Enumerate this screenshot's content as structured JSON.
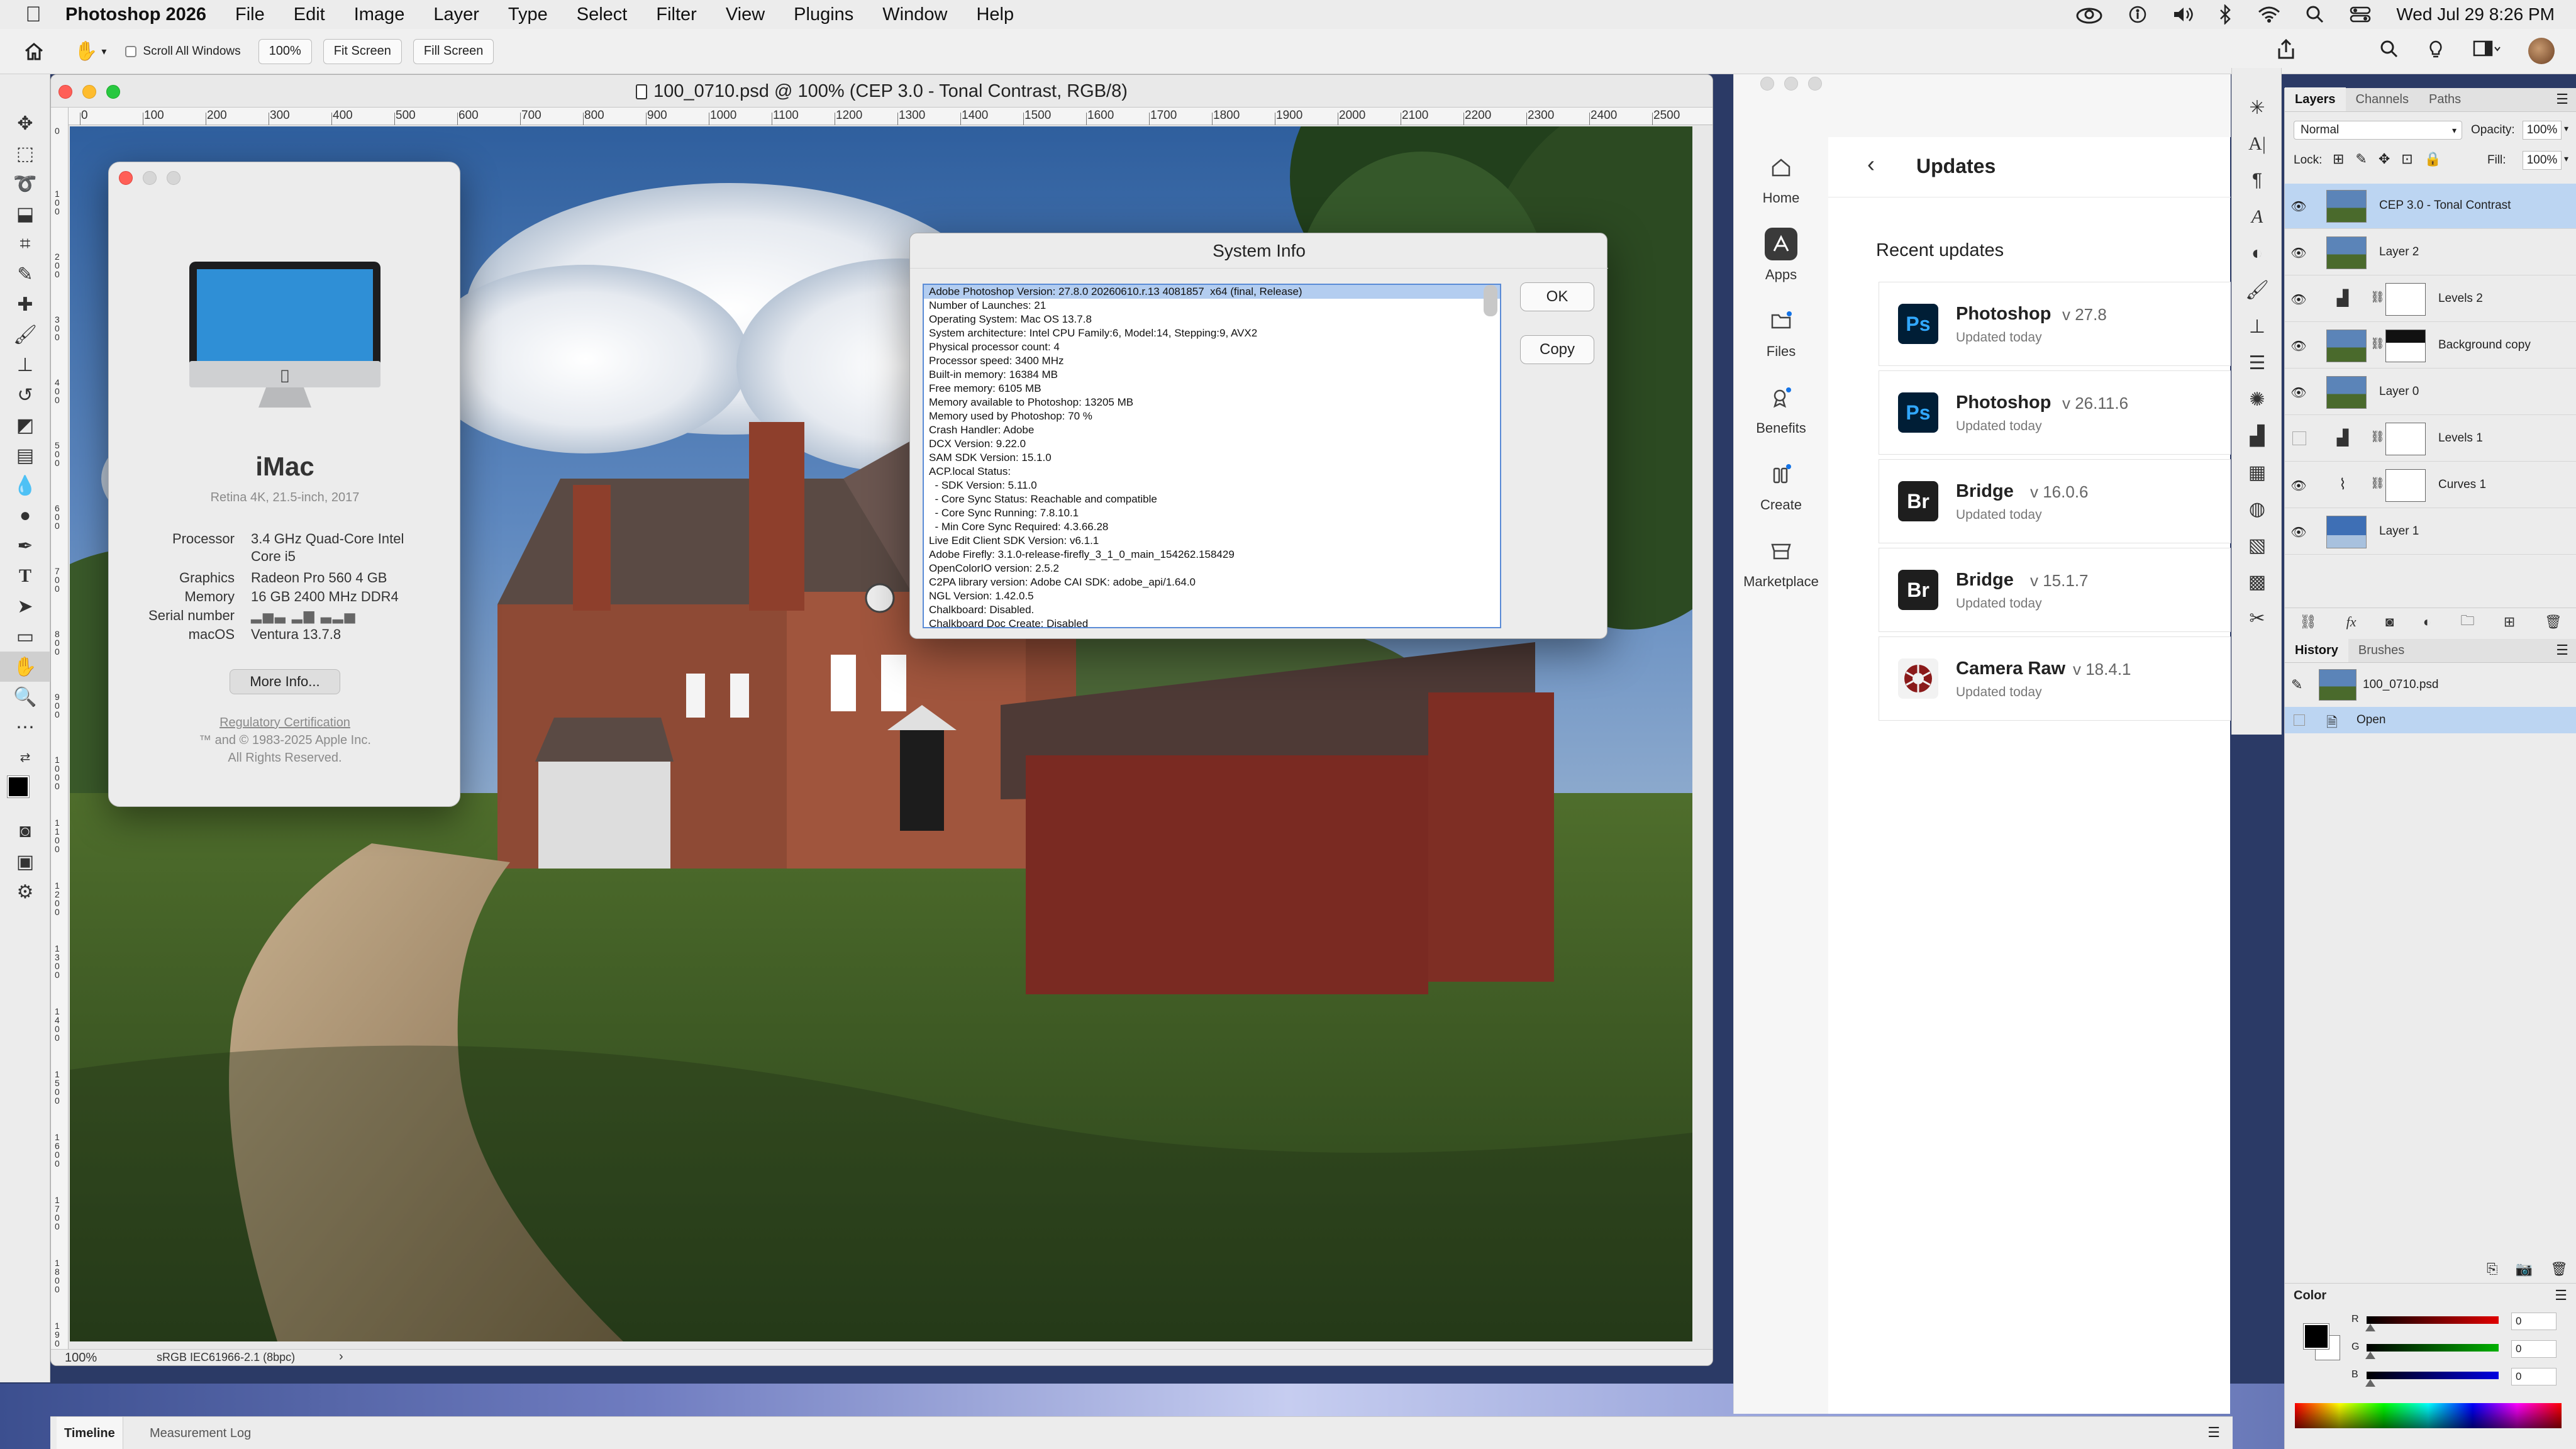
{
  "menubar": {
    "app_name": "Photoshop 2026",
    "items": [
      "File",
      "Edit",
      "Image",
      "Layer",
      "Type",
      "Select",
      "Filter",
      "View",
      "Plugins",
      "Window",
      "Help"
    ],
    "clock": "Wed Jul 29  8:26 PM"
  },
  "options_bar": {
    "scroll_all_windows": "Scroll All Windows",
    "zoom_button": "100%",
    "fit_screen": "Fit Screen",
    "fill_screen": "Fill Screen"
  },
  "document": {
    "title": "100_0710.psd @ 100% (CEP 3.0 - Tonal Contrast, RGB/8)",
    "ruler_h": [
      "0",
      "100",
      "200",
      "300",
      "400",
      "500",
      "600",
      "700",
      "800",
      "900",
      "1000",
      "1100",
      "1200",
      "1300",
      "1400",
      "1500",
      "1600",
      "1700",
      "1800",
      "1900",
      "2000",
      "2100",
      "2200",
      "2300",
      "2400",
      "2500"
    ],
    "ruler_v": [
      "0",
      "100",
      "200",
      "300",
      "400",
      "500",
      "600",
      "700",
      "800",
      "900",
      "1000",
      "1100",
      "1200",
      "1300",
      "1400",
      "1500",
      "1600",
      "1700",
      "1800",
      "1900"
    ],
    "zoom": "100%",
    "color_profile": "sRGB IEC61966-2.1 (8bpc)",
    "status_arrow": "›"
  },
  "about_mac": {
    "model": "iMac",
    "subtitle": "Retina 4K, 21.5-inch, 2017",
    "specs": [
      {
        "k": "Processor",
        "v": "3.4 GHz Quad-Core Intel"
      },
      {
        "k": "",
        "v": "Core i5"
      },
      {
        "k": "Graphics",
        "v": "Radeon Pro 560 4 GB"
      },
      {
        "k": "Memory",
        "v": "16 GB 2400 MHz DDR4"
      },
      {
        "k": "Serial number",
        "v": ""
      },
      {
        "k": "macOS",
        "v": "Ventura 13.7.8"
      }
    ],
    "more_info": "More Info...",
    "regulatory": "Regulatory Certification",
    "copyright": "™ and © 1983-2025 Apple Inc.",
    "rights": "All Rights Reserved."
  },
  "system_info": {
    "title": "System Info",
    "ok": "OK",
    "copy": "Copy",
    "lines": [
      "Adobe Photoshop Version: 27.8.0 20260610.r.13 4081857  x64 (final, Release)",
      "Number of Launches: 21",
      "Operating System: Mac OS 13.7.8",
      "System architecture: Intel CPU Family:6, Model:14, Stepping:9, AVX2",
      "Physical processor count: 4",
      "Processor speed: 3400 MHz",
      "Built-in memory: 16384 MB",
      "Free memory: 6105 MB",
      "Memory available to Photoshop: 13205 MB",
      "Memory used by Photoshop: 70 %",
      "Crash Handler: Adobe",
      "DCX Version: 9.22.0",
      "SAM SDK Version: 15.1.0",
      "ACP.local Status:",
      "  - SDK Version: 5.11.0",
      "  - Core Sync Status: Reachable and compatible",
      "  - Core Sync Running: 7.8.10.1",
      "  - Min Core Sync Required: 4.3.66.28",
      "Live Edit Client SDK Version: v6.1.1",
      "Adobe Firefly: 3.1.0-release-firefly_3_1_0_main_154262.158429",
      "OpenColorIO version: 2.5.2",
      "C2PA library version: Adobe CAI SDK: adobe_api/1.64.0",
      "NGL Version: 1.42.0.5",
      "Chalkboard: Disabled.",
      "Chalkboard Doc Create: Disabled"
    ]
  },
  "creative_cloud": {
    "nav": [
      {
        "label": "Home",
        "icon": "home-icon"
      },
      {
        "label": "Apps",
        "icon": "apps-icon"
      },
      {
        "label": "Files",
        "icon": "files-icon"
      },
      {
        "label": "Benefits",
        "icon": "benefits-icon"
      },
      {
        "label": "Create",
        "icon": "create-icon"
      },
      {
        "label": "Marketplace",
        "icon": "marketplace-icon"
      }
    ],
    "page_title": "Updates",
    "section_title": "Recent updates",
    "apps": [
      {
        "logo": "Ps",
        "name": "Photoshop",
        "version": "v 27.8",
        "status": "Updated today",
        "color": "#001e36",
        "fg": "#31a8ff"
      },
      {
        "logo": "Ps",
        "name": "Photoshop",
        "version": "v 26.11.6",
        "status": "Updated today",
        "color": "#001e36",
        "fg": "#31a8ff"
      },
      {
        "logo": "Br",
        "name": "Bridge",
        "version": "v 16.0.6",
        "status": "Updated today",
        "color": "#1e1e1e",
        "fg": "#ffffff"
      },
      {
        "logo": "Br",
        "name": "Bridge",
        "version": "v 15.1.7",
        "status": "Updated today",
        "color": "#1e1e1e",
        "fg": "#ffffff"
      },
      {
        "logo": "",
        "name": "Camera Raw",
        "version": "v 18.4.1",
        "status": "Updated today",
        "color": "#f2f2f2",
        "fg": "#8a1a1a"
      }
    ]
  },
  "layers_panel": {
    "tabs": [
      "Layers",
      "Channels",
      "Paths"
    ],
    "blend_mode": "Normal",
    "opacity_label": "Opacity:",
    "opacity": "100%",
    "lock_label": "Lock:",
    "fill_label": "Fill:",
    "fill": "100%",
    "layers": [
      {
        "name": "CEP 3.0 - Tonal Contrast",
        "kind": "image",
        "selected": true,
        "visible": true
      },
      {
        "name": "Layer 2",
        "kind": "image",
        "selected": false,
        "visible": true
      },
      {
        "name": "Levels 2",
        "kind": "levels",
        "selected": false,
        "visible": true
      },
      {
        "name": "Background copy",
        "kind": "masked",
        "selected": false,
        "visible": true
      },
      {
        "name": "Layer 0",
        "kind": "image",
        "selected": false,
        "visible": true
      },
      {
        "name": "Levels 1",
        "kind": "levels",
        "selected": false,
        "visible": false
      },
      {
        "name": "Curves 1",
        "kind": "curves",
        "selected": false,
        "visible": true
      },
      {
        "name": "Layer 1",
        "kind": "sky",
        "selected": false,
        "visible": true
      }
    ]
  },
  "history_panel": {
    "tabs": [
      "History",
      "Brushes"
    ],
    "snapshot": "100_0710.psd",
    "steps": [
      "Open"
    ]
  },
  "color_panel": {
    "title": "Color",
    "channels": [
      {
        "label": "R",
        "value": "0",
        "color": "#e00000"
      },
      {
        "label": "G",
        "value": "0",
        "color": "#00b000"
      },
      {
        "label": "B",
        "value": "0",
        "color": "#0000e0"
      }
    ]
  },
  "bottom_tabs": [
    "Timeline",
    "Measurement Log"
  ]
}
